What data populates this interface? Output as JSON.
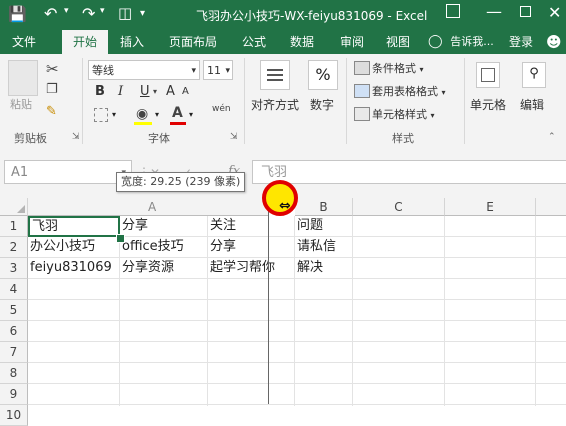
{
  "title": {
    "filename": "飞羽办公小技巧-WX-feiyu831069",
    "separator": " - ",
    "app": "Excel"
  },
  "tabs": [
    "文件",
    "开始",
    "插入",
    "页面布局",
    "公式",
    "数据",
    "审阅",
    "视图"
  ],
  "active_tab": "开始",
  "tell_me": "告诉我...",
  "login": "登录",
  "ribbon": {
    "clipboard": {
      "paste": "粘贴",
      "group": "剪贴板"
    },
    "font": {
      "name": "等线",
      "size": "11",
      "group": "字体",
      "bold": "B",
      "italic": "I",
      "underline": "U",
      "grow": "A",
      "shrink": "A",
      "wen": "wén"
    },
    "alignment": {
      "label": "对齐方式"
    },
    "number": {
      "label": "数字",
      "symbol": "%"
    },
    "styles": {
      "conditional": "条件格式",
      "table": "套用表格格式",
      "cell": "单元格样式",
      "group": "样式"
    },
    "cells": {
      "label": "单元格"
    },
    "editing": {
      "label": "编辑"
    }
  },
  "formula_bar": {
    "name_box": "A1",
    "fx": "fx",
    "value": "飞羽"
  },
  "tooltip": "宽度: 29.25 (239 像素)",
  "columns": [
    "A",
    "B",
    "C",
    "E"
  ],
  "rows": [
    "1",
    "2",
    "3",
    "4",
    "5",
    "6",
    "7",
    "8",
    "9",
    "10"
  ],
  "cells": [
    {
      "r": 1,
      "a": "飞羽",
      "a2": "分享",
      "a3": "关注",
      "b": "问题"
    },
    {
      "r": 2,
      "a": "办公小技巧",
      "a2": "office技巧",
      "a3": "分享",
      "b": "请私信"
    },
    {
      "r": 3,
      "a": "feiyu831069",
      "a2": "分享资源",
      "a3": "起学习帮你",
      "b": "解决"
    }
  ],
  "colors": {
    "brand": "#217346",
    "cursor_ring": "#e00000",
    "cursor_fill": "#ffe600"
  }
}
